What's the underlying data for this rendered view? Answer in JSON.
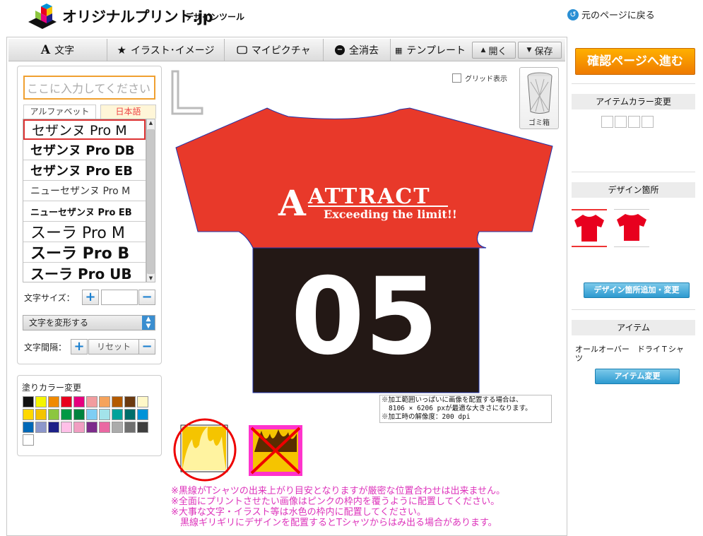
{
  "header": {
    "logo_text": "オリジナルプリント.jp",
    "logo_sub": "デザインツール",
    "back_link": "元のページに戻る"
  },
  "toolbar": {
    "text": "文字",
    "illust": "イラスト･イメージ",
    "mypicture": "マイピクチャ",
    "clear_all": "全消去",
    "template": "テンプレート",
    "open": "開く",
    "save": "保存"
  },
  "text_panel": {
    "input_placeholder": "ここに入力してください",
    "tab_alphabet": "アルファベット",
    "tab_japanese": "日本語",
    "fonts": [
      "セザンヌ Pro M",
      "セザンヌ Pro DB",
      "セザンヌ Pro EB",
      "ニューセザンヌ Pro M",
      "ニューセザンヌ Pro EB",
      "スーラ Pro M",
      "スーラ Pro B",
      "スーラ Pro UB"
    ],
    "size_label": "文字サイズ：",
    "transform_label": "文字を変形する",
    "spacing_label": "文字間隔：",
    "reset_label": "リセット"
  },
  "color_panel": {
    "title": "塗りカラー変更",
    "swatches": [
      "#111111",
      "#f5f500",
      "#f08a00",
      "#e8001e",
      "#e6007e",
      "#f29c9f",
      "#f5a35c",
      "#b35a00",
      "#6b3a10",
      "#fff8c8",
      "#ffd800",
      "#f5c400",
      "#8cc63f",
      "#009944",
      "#00833e",
      "#7ecef4",
      "#a3e3ea",
      "#00a29a",
      "#006e6a",
      "#0093d8",
      "#0068b7",
      "#8c97cb",
      "#1d2088",
      "#ffc0e8",
      "#f19ec2",
      "#7d2b8b",
      "#ea68a2",
      "#ababab",
      "#6f6f6f",
      "#3e3e3e",
      "#ffffff"
    ]
  },
  "canvas": {
    "grid_label": "グリッド表示",
    "trash_label": "ゴミ箱",
    "design_title": "ATTRACT",
    "design_subtitle": "Exceeding the limit!!",
    "design_number": "05",
    "shirt_body_color": "#e8392a",
    "shirt_lower_color": "#231815",
    "info_note_line1": "※加工範囲いっぱいに画像を配置する場合は、",
    "info_note_line2": "8106 × 6206 pxが最適な大きさになります。",
    "info_note_line3": "※加工時の解像度：200 dpi"
  },
  "notes": [
    "※黒線がTシャツの出来上がり目安となりますが厳密な位置合わせは出来ません。",
    "※全面にプリントさせたい画像はピンクの枠内を覆うように配置してください。",
    "※大事な文字・イラスト等は水色の枠内に配置してください。",
    "　黒線ギリギリにデザインを配置するとTシャツからはみ出る場合があります。"
  ],
  "sidebar": {
    "confirm_button": "確認ページへ進む",
    "item_color_title": "アイテムカラー変更",
    "design_area_title": "デザイン箇所",
    "design_area_button": "デザイン箇所追加・変更",
    "item_title": "アイテム",
    "item_name": "オールオーバー　ドライＴシャツ",
    "item_change_button": "アイテム変更",
    "shirt_color": "#e8001e"
  }
}
